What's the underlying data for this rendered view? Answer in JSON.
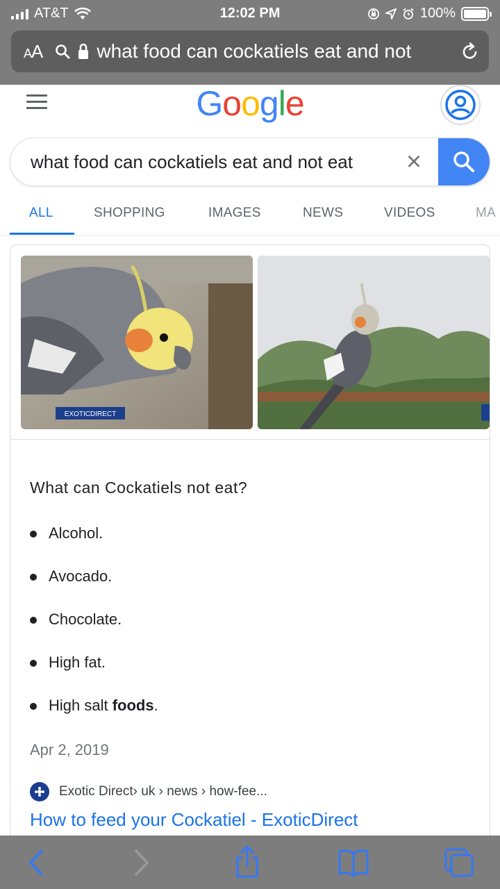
{
  "status": {
    "carrier": "AT&T",
    "time": "12:02 PM",
    "battery": "100%",
    "battery_level": 1.0
  },
  "safari": {
    "text_size_label_small": "A",
    "text_size_label_big": "A",
    "url": "what food can cockatiels eat and not"
  },
  "google": {
    "logo_letters": [
      {
        "ch": "G",
        "color": "#4285f4"
      },
      {
        "ch": "o",
        "color": "#ea4335"
      },
      {
        "ch": "o",
        "color": "#fbbc05"
      },
      {
        "ch": "g",
        "color": "#4285f4"
      },
      {
        "ch": "l",
        "color": "#34a853"
      },
      {
        "ch": "e",
        "color": "#ea4335"
      }
    ]
  },
  "search": {
    "query": "what food can cockatiels eat and not eat",
    "clear_label": "×"
  },
  "tabs": [
    "ALL",
    "SHOPPING",
    "IMAGES",
    "NEWS",
    "VIDEOS",
    "MA"
  ],
  "snippet": {
    "image_1_watermark": "EXOTICDIRECT",
    "question": "What can Cockatiels not eat?",
    "items": [
      {
        "text": "Alcohol.",
        "bold": ""
      },
      {
        "text": "Avocado.",
        "bold": ""
      },
      {
        "text": "Chocolate.",
        "bold": ""
      },
      {
        "text": "High fat.",
        "bold": ""
      },
      {
        "text": "High salt ",
        "bold": "foods",
        "after": "."
      }
    ],
    "date": "Apr 2, 2019",
    "source_name": "Exotic Direct",
    "source_path": " › uk › news › how-fee...",
    "link_title": "How to feed your Cockatiel - ExoticDirect"
  },
  "colors": {
    "accent": "#1a73e8",
    "search_button": "#4285f4",
    "chrome": "#7d7d7d"
  }
}
